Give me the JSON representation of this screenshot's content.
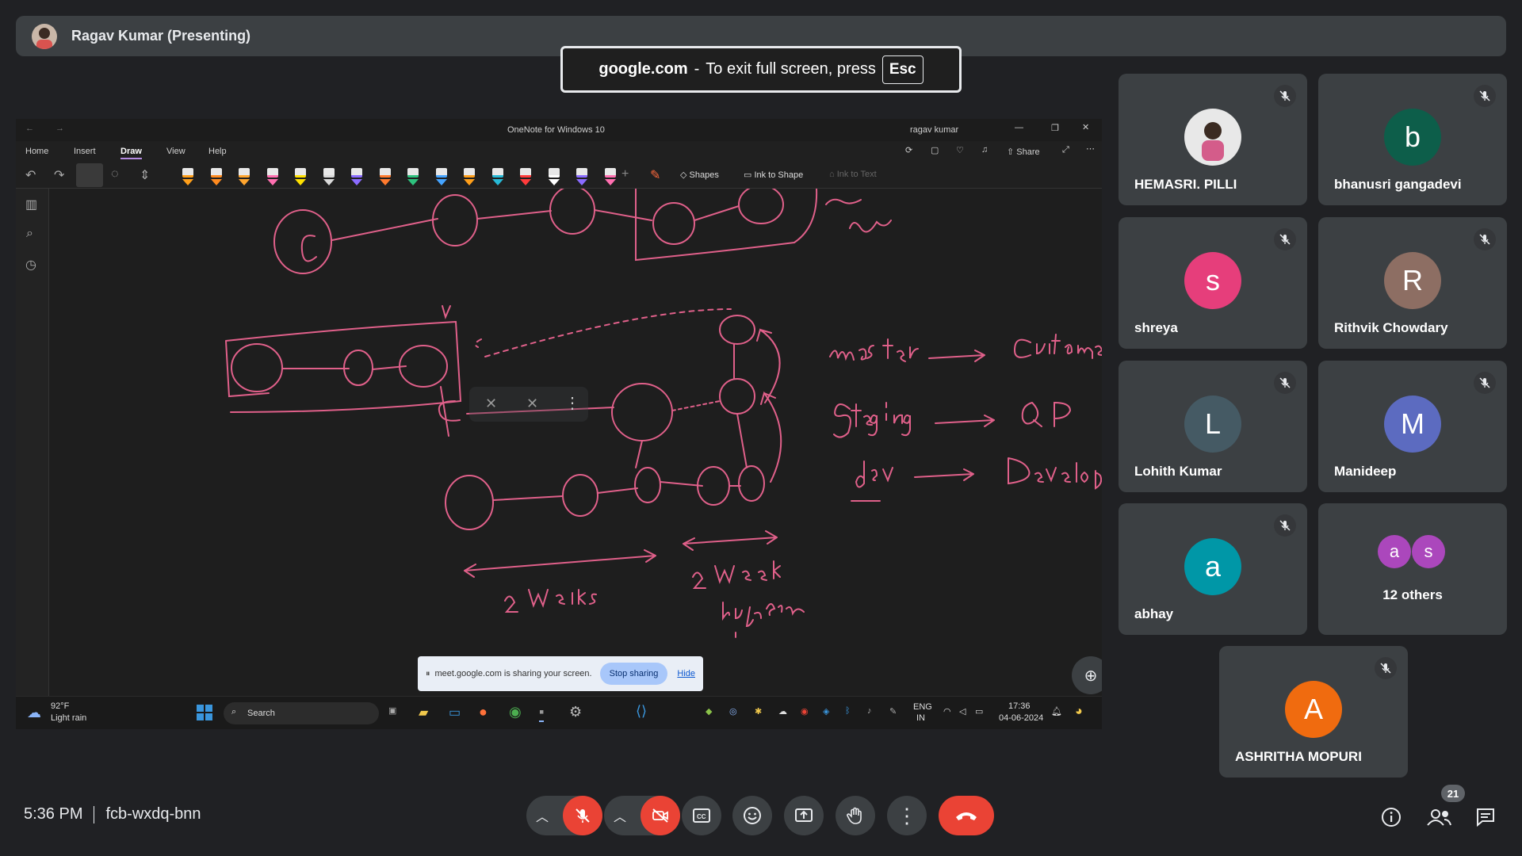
{
  "presenter": {
    "name": "Ragav Kumar (Presenting)"
  },
  "fullscreen_notice": {
    "domain": "google.com",
    "text": "To exit full screen, press",
    "key": "Esc"
  },
  "onenote": {
    "title": "OneNote for Windows 10",
    "user": "ragav kumar",
    "menu": [
      "Home",
      "Insert",
      "Draw",
      "View",
      "Help"
    ],
    "active_menu": "Draw",
    "share_label": "Share",
    "tools": {
      "shapes": "Shapes",
      "ink_to_shape": "Ink to Shape",
      "ink_to_text": "Ink to Text"
    },
    "pen_colors": [
      "#ff9f1a",
      "#ff8a1f",
      "#ffa52e",
      "#ff6fb0",
      "#ffe100",
      "#d9d9d9",
      "#8a6bff",
      "#ff7a2e",
      "#2ec27e",
      "#45a4ff",
      "#ff9f1a",
      "#27b9d6",
      "#ff3b3b",
      "#ffffff",
      "#8a6bff",
      "#ff6fb0"
    ],
    "ink_color": "#e0608a"
  },
  "sharing_bar": {
    "text": "meet.google.com is sharing your screen.",
    "stop": "Stop sharing",
    "hide": "Hide"
  },
  "taskbar": {
    "weather_temp": "92°F",
    "weather_desc": "Light rain",
    "search": "Search",
    "lang1": "ENG",
    "lang2": "IN",
    "time": "17:36",
    "date": "04-06-2024"
  },
  "participants": [
    {
      "name": "HEMASRI. PILLI",
      "initial": "",
      "color": "#e8e8e8"
    },
    {
      "name": "bhanusri gangadevi",
      "initial": "b",
      "color": "#0d5e4a"
    },
    {
      "name": "shreya",
      "initial": "s",
      "color": "#e63e7b"
    },
    {
      "name": "Rithvik Chowdary",
      "initial": "R",
      "color": "#8d6e63"
    },
    {
      "name": "Lohith Kumar",
      "initial": "L",
      "color": "#455a64"
    },
    {
      "name": "Manideep",
      "initial": "M",
      "color": "#5c6bc0"
    },
    {
      "name": "abhay",
      "initial": "a",
      "color": "#0097a7"
    },
    {
      "name": "ASHRITHA MOPURI",
      "initial": "A",
      "color": "#f06b0f"
    }
  ],
  "others": {
    "label": "12 others",
    "initials": [
      "a",
      "s"
    ],
    "colors": [
      "#ab47bc",
      "#ab47bc"
    ]
  },
  "meeting": {
    "time": "5:36 PM",
    "code": "fcb-wxdq-bnn",
    "participant_count": "21"
  }
}
